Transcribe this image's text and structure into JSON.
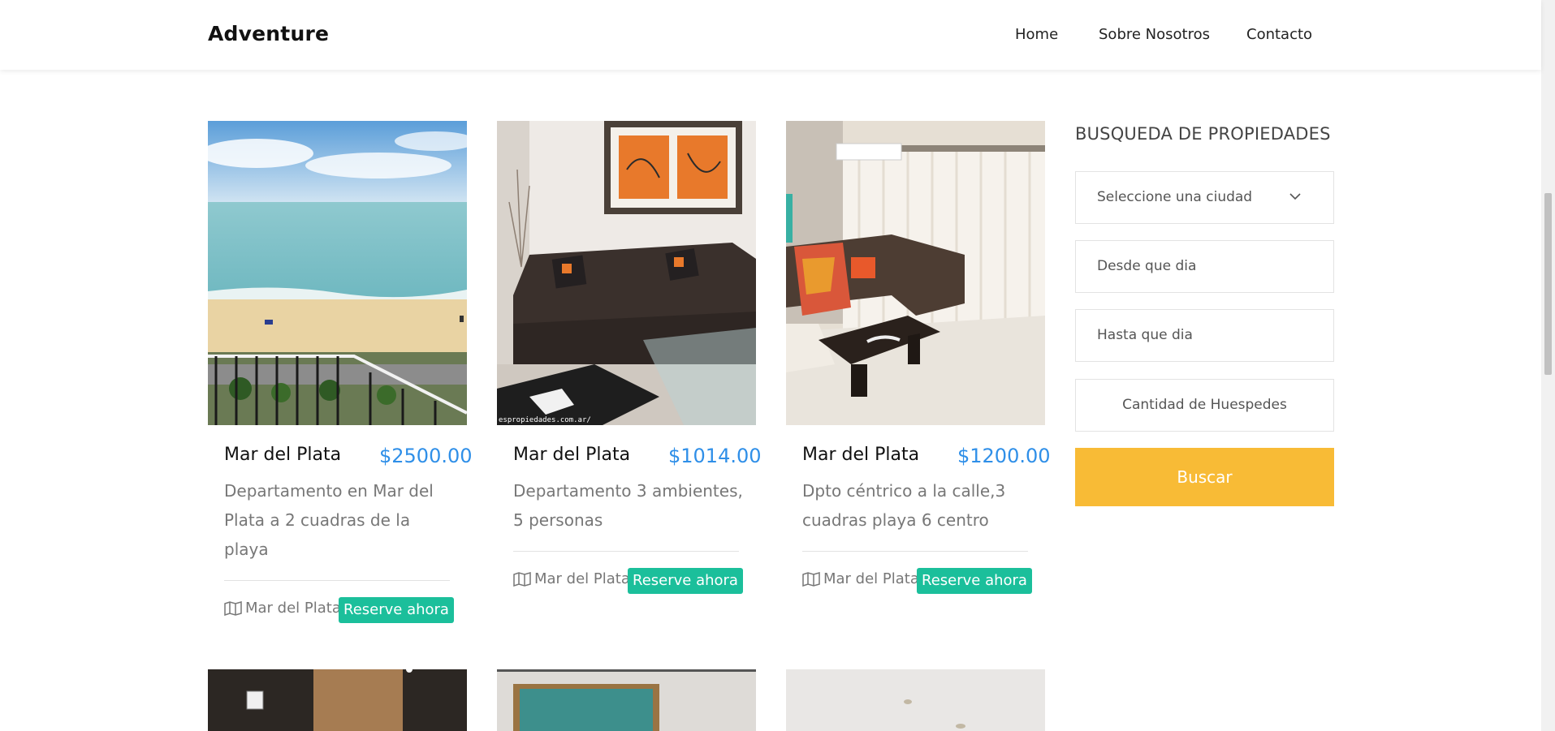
{
  "header": {
    "brand": "Adventure",
    "nav": [
      "Home",
      "Sobre Nosotros",
      "Contacto"
    ]
  },
  "listings": [
    {
      "city": "Mar del Plata",
      "price": "$2500.00",
      "description": "Departamento en Mar del Plata a 2 cuadras de la playa",
      "location": "Mar del Plata",
      "cta": "Reserve ahora"
    },
    {
      "city": "Mar del Plata",
      "price": "$1014.00",
      "description": "Departamento 3 ambientes, 5 personas",
      "location": "Mar del Plata",
      "cta": "Reserve ahora",
      "watermark": "espropiedades.com.ar/"
    },
    {
      "city": "Mar del Plata",
      "price": "$1200.00",
      "description": "Dpto céntrico a la calle,3 cuadras playa 6 centro",
      "location": "Mar del Plata",
      "cta": "Reserve ahora"
    }
  ],
  "search": {
    "title": "BUSQUEDA DE PROPIEDADES",
    "city_select": "Seleccione una ciudad",
    "from_placeholder": "Desde que dia",
    "to_placeholder": "Hasta que dia",
    "guests_placeholder": "Cantidad de Huespedes",
    "button": "Buscar"
  },
  "colors": {
    "price": "#2f8fe8",
    "reserve": "#1bbf9b",
    "buscar": "#f8bb36"
  },
  "icons": [
    "map-icon",
    "chevron-down-icon"
  ]
}
